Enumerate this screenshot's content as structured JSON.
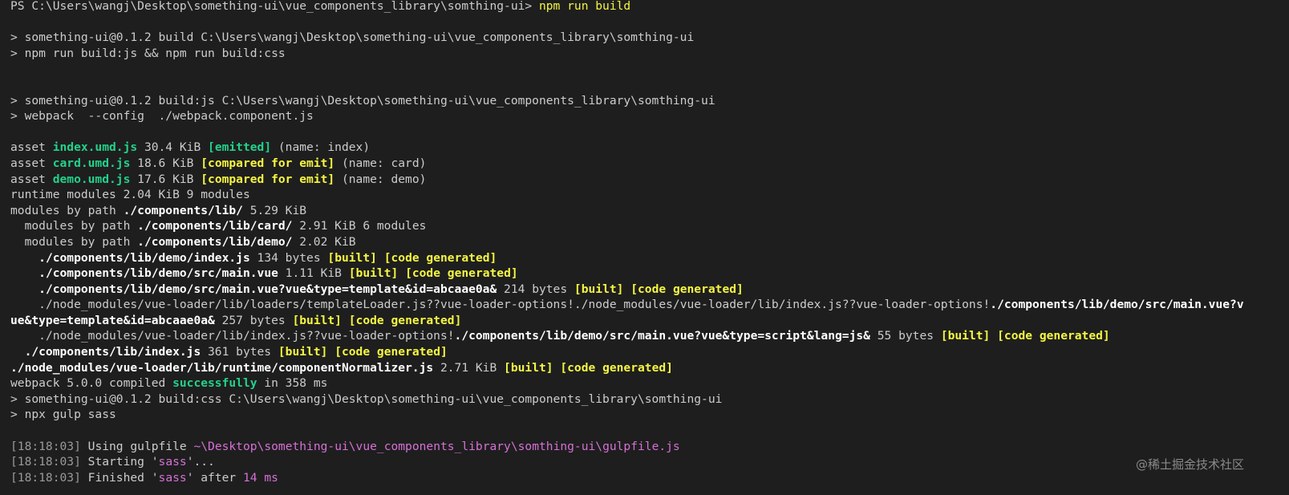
{
  "prompt": {
    "ps": "PS ",
    "path": "C:\\Users\\wangj\\Desktop\\something-ui\\vue_components_library\\somthing-ui>",
    "command": "npm run build"
  },
  "lines": {
    "l1": "> something-ui@0.1.2 build C:\\Users\\wangj\\Desktop\\something-ui\\vue_components_library\\somthing-ui",
    "l2": "> npm run build:js && npm run build:css",
    "l3": "> something-ui@0.1.2 build:js C:\\Users\\wangj\\Desktop\\something-ui\\vue_components_library\\somthing-ui",
    "l4": "> webpack  --config  ./webpack.component.js"
  },
  "assets": [
    {
      "prefix": "asset ",
      "name": "index.umd.js",
      "size": " 30.4 KiB ",
      "status": "[emitted]",
      "meta": " (name: index)"
    },
    {
      "prefix": "asset ",
      "name": "card.umd.js",
      "size": " 18.6 KiB ",
      "status": "[compared for emit]",
      "meta": " (name: card)"
    },
    {
      "prefix": "asset ",
      "name": "demo.umd.js",
      "size": " 17.6 KiB ",
      "status": "[compared for emit]",
      "meta": " (name: demo)"
    }
  ],
  "modules": {
    "runtime": "runtime modules 2.04 KiB 9 modules",
    "bypath_prefix": "modules by path ",
    "bypath_path": "./components/lib/",
    "bypath_size": " 5.29 KiB",
    "card_prefix": "  modules by path ",
    "card_path": "./components/lib/card/",
    "card_size": " 2.91 KiB 6 modules",
    "demo_prefix": "  modules by path ",
    "demo_path": "./components/lib/demo/",
    "demo_size": " 2.02 KiB",
    "m1_indent": "    ",
    "m1_path": "./components/lib/demo/index.js",
    "m1_size": " 134 bytes ",
    "m2_path": "./components/lib/demo/src/main.vue",
    "m2_size": " 1.11 KiB ",
    "m3_path": "./components/lib/demo/src/main.vue?vue&type=template&id=abcaae0a&",
    "m3_size": " 214 bytes ",
    "m4a_loader": "./node_modules/vue-loader/lib/loaders/templateLoader.js??vue-loader-options!./node_modules/vue-loader/lib/index.js??vue-loader-options!",
    "m4a_path": "./components/lib/demo/src/main.vue?v",
    "m4b_path": "ue&type=template&id=abcaae0a&",
    "m4b_size": " 257 bytes ",
    "m5_loader": "./node_modules/vue-loader/lib/index.js??vue-loader-options!",
    "m5_path": "./components/lib/demo/src/main.vue?vue&type=script&lang=js&",
    "m5_size": " 55 bytes ",
    "m6_indent": "  ",
    "m6_path": "./components/lib/index.js",
    "m6_size": " 361 bytes ",
    "m7_path": "./node_modules/vue-loader/lib/runtime/componentNormalizer.js",
    "m7_size": " 2.71 KiB ",
    "built": "[built]",
    "code_generated": "[code generated]"
  },
  "webpack": {
    "prefix": "webpack 5.0.0 compiled ",
    "success": "successfully",
    "suffix": " in 358 ms"
  },
  "css": {
    "l1": "> something-ui@0.1.2 build:css C:\\Users\\wangj\\Desktop\\something-ui\\vue_components_library\\somthing-ui",
    "l2": "> npx gulp sass"
  },
  "gulp": {
    "ts": "[18:18:03]",
    "using": " Using gulpfile ",
    "gulpfile": "~\\Desktop\\something-ui\\vue_components_library\\somthing-ui\\gulpfile.js",
    "starting": " Starting '",
    "task": "sass",
    "ellipsis": "'...",
    "finished": " Finished '",
    "after": "' after ",
    "duration": "14 ms"
  },
  "watermark": "@稀土掘金技术社区",
  "colors": {
    "background": "#1e1e1e",
    "text": "#cccccc",
    "green": "#23d18b",
    "yellow": "#f5f543",
    "magenta": "#d670d6"
  }
}
